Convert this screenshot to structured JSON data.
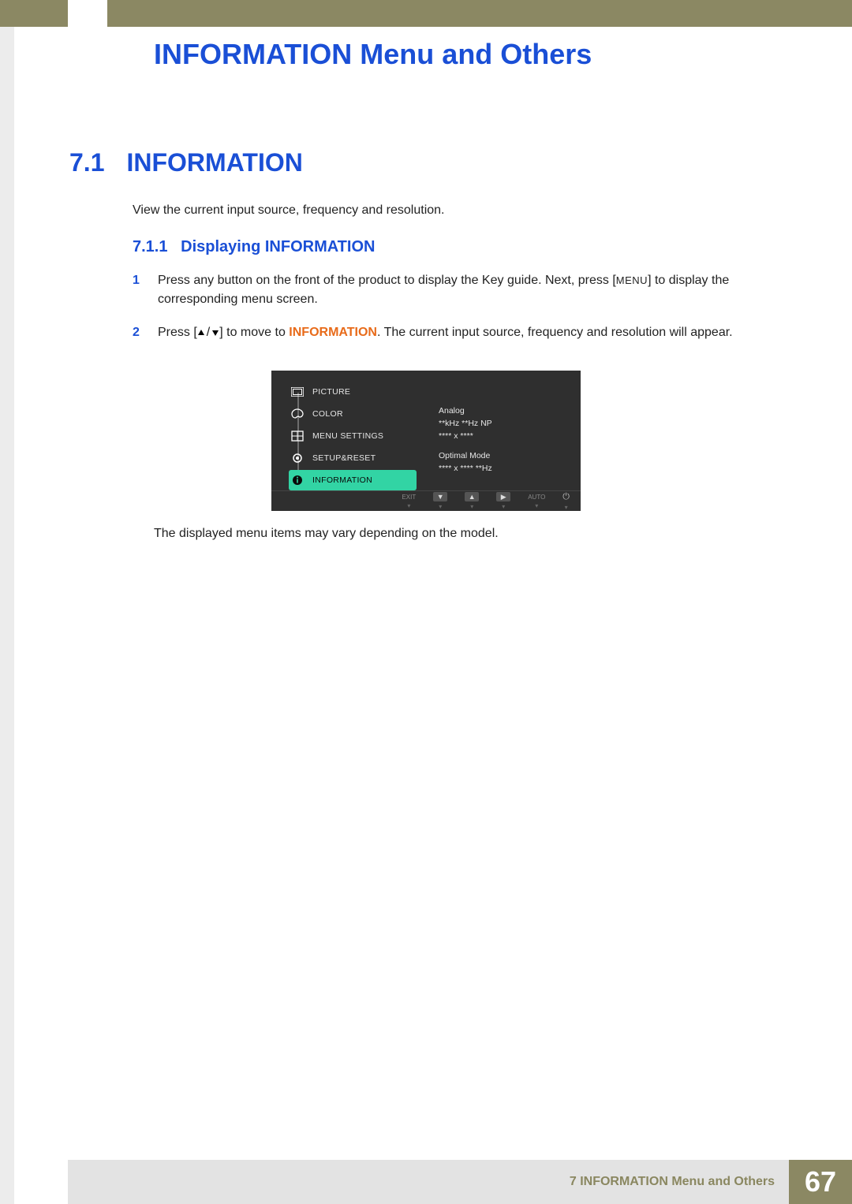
{
  "chapter_title": "INFORMATION Menu and Others",
  "section": {
    "number": "7.1",
    "title": "INFORMATION",
    "intro": "View the current input source, frequency and resolution."
  },
  "subsection": {
    "number": "7.1.1",
    "title": "Displaying INFORMATION"
  },
  "steps": [
    {
      "num": "1",
      "pre": "Press any button on the front of the product to display the Key guide. Next, press [",
      "key": "MENU",
      "post": "] to display the corresponding menu screen."
    },
    {
      "num": "2",
      "pre": "Press [",
      "post_bracket": "] to move to ",
      "highlight": "INFORMATION",
      "post": ". The current input source, frequency and resolution will appear."
    }
  ],
  "osd": {
    "menu_items": [
      "PICTURE",
      "COLOR",
      "MENU SETTINGS",
      "SETUP&RESET",
      "INFORMATION"
    ],
    "selected_index": 4,
    "info_panel": {
      "line1": "Analog",
      "line2": "**kHz  **Hz  NP",
      "line3": "**** x ****",
      "line4": "Optimal Mode",
      "line5": "**** x ****  **Hz"
    },
    "footer": {
      "exit": "EXIT",
      "auto": "AUTO"
    }
  },
  "caption": "The displayed menu items may vary depending on the model.",
  "footer": {
    "text": "7 INFORMATION Menu and Others",
    "page": "67"
  }
}
